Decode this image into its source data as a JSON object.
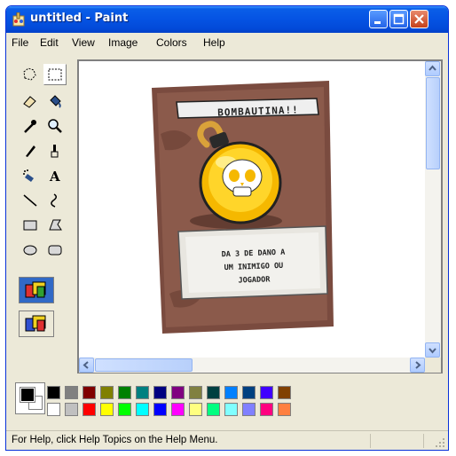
{
  "window": {
    "title": "untitled - Paint"
  },
  "menu": {
    "items": [
      "File",
      "Edit",
      "View",
      "Image",
      "Colors",
      "Help"
    ]
  },
  "toolbox": {
    "tools": [
      "free-form-select-icon",
      "rect-select-icon",
      "eraser-icon",
      "fill-bucket-icon",
      "color-picker-icon",
      "magnifier-icon",
      "pencil-icon",
      "brush-icon",
      "airbrush-icon",
      "text-icon",
      "line-icon",
      "curve-icon",
      "rectangle-icon",
      "polygon-icon",
      "ellipse-icon",
      "rounded-rectangle-icon"
    ],
    "selected_tool": "rect-select-icon"
  },
  "card": {
    "title": "BOMBAUTINA!!",
    "description_lines": [
      "DA 3 DE DANO A",
      "UM INIMIGO OU",
      "JOGADOR"
    ]
  },
  "palette": {
    "foreground": "#000000",
    "background": "#ffffff",
    "top_row": [
      "#000000",
      "#808080",
      "#800000",
      "#808000",
      "#008000",
      "#008080",
      "#000080",
      "#800080",
      "#808040",
      "#004040",
      "#0080ff",
      "#004080",
      "#4000ff",
      "#804000"
    ],
    "bottom_row": [
      "#ffffff",
      "#c0c0c0",
      "#ff0000",
      "#ffff00",
      "#00ff00",
      "#00ffff",
      "#0000ff",
      "#ff00ff",
      "#ffff80",
      "#00ff80",
      "#80ffff",
      "#8080ff",
      "#ff0080",
      "#ff8040"
    ]
  },
  "status": {
    "text": "For Help, click Help Topics on the Help Menu."
  }
}
